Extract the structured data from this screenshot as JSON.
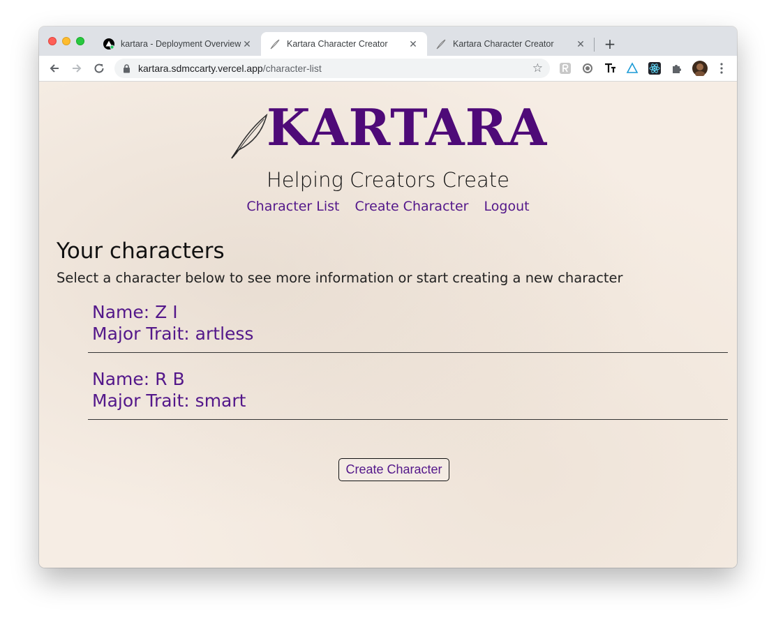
{
  "browser": {
    "tabs": [
      {
        "title": "kartara - Deployment Overview",
        "close": "✕"
      },
      {
        "title": "Kartara Character Creator",
        "close": "✕"
      },
      {
        "title": "Kartara Character Creator",
        "close": "✕"
      }
    ],
    "new_tab": "+",
    "url_host": "kartara.sdmccarty.vercel.app",
    "url_path": "/character-list"
  },
  "site": {
    "logo_text": "KARTARA",
    "tagline": "Helping Creators Create",
    "nav": [
      "Character List",
      "Create Character",
      "Logout"
    ],
    "accent_color": "#53178a"
  },
  "page": {
    "heading": "Your characters",
    "subtext": "Select a character below to see more information or start creating a new character",
    "characters": [
      {
        "name": "Name: Z I",
        "trait": "Major Trait: artless"
      },
      {
        "name": "Name: R B",
        "trait": "Major Trait: smart"
      }
    ],
    "create_button": "Create Character"
  }
}
